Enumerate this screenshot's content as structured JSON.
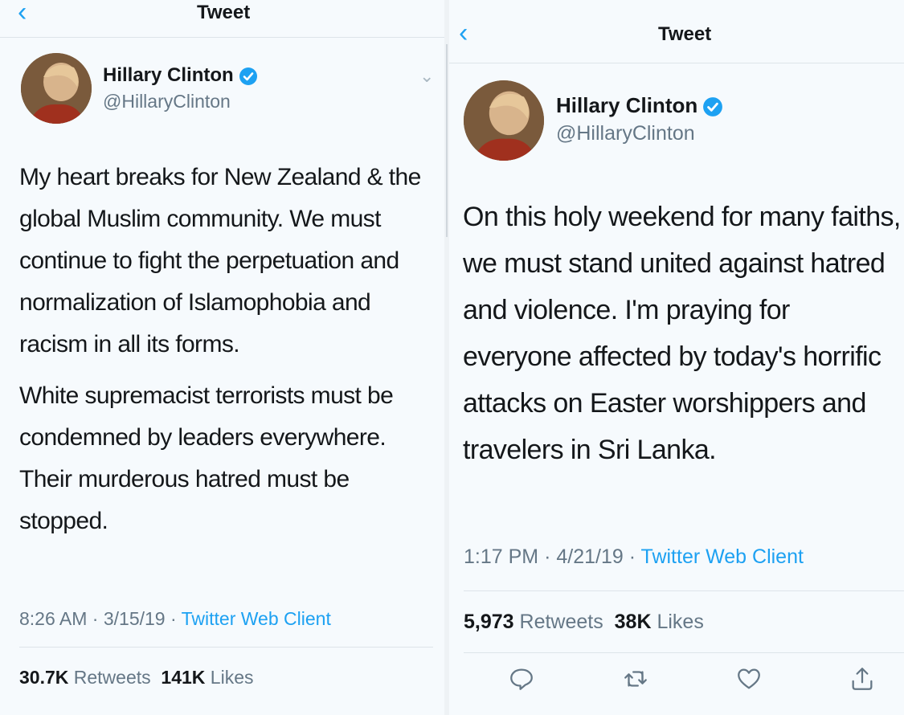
{
  "left": {
    "header_title": "Tweet",
    "user": {
      "name": "Hillary Clinton",
      "handle": "@HillaryClinton"
    },
    "paragraph1": "My heart breaks for New Zealand & the global Muslim community. We must continue to fight the perpetuation and normalization of Islamophobia and racism in all its forms.",
    "paragraph2": "White supremacist terrorists must be condemned by leaders everywhere. Their murderous hatred must be stopped.",
    "time": "8:26 AM",
    "date": "3/15/19",
    "client": "Twitter Web Client",
    "retweets_count": "30.7K",
    "retweets_label": "Retweets",
    "likes_count": "141K",
    "likes_label": "Likes"
  },
  "right": {
    "header_title": "Tweet",
    "user": {
      "name": "Hillary Clinton",
      "handle": "@HillaryClinton"
    },
    "paragraph1": "On this holy weekend for many faiths, we must stand united against hatred and violence. I'm praying for everyone affected by today's horrific attacks on Easter worshippers and travelers in Sri Lanka.",
    "time": "1:17 PM",
    "date": "4/21/19",
    "client": "Twitter Web Client",
    "retweets_count": "5,973",
    "retweets_label": "Retweets",
    "likes_count": "38K",
    "likes_label": "Likes"
  },
  "meta_separator": "·",
  "colors": {
    "accent": "#1da1f2",
    "secondary_text": "#657786",
    "primary_text": "#14171a"
  },
  "icons": [
    "back-chevron-icon",
    "verified-badge-icon",
    "chevron-down-icon",
    "reply-icon",
    "retweet-icon",
    "like-icon",
    "share-icon"
  ]
}
